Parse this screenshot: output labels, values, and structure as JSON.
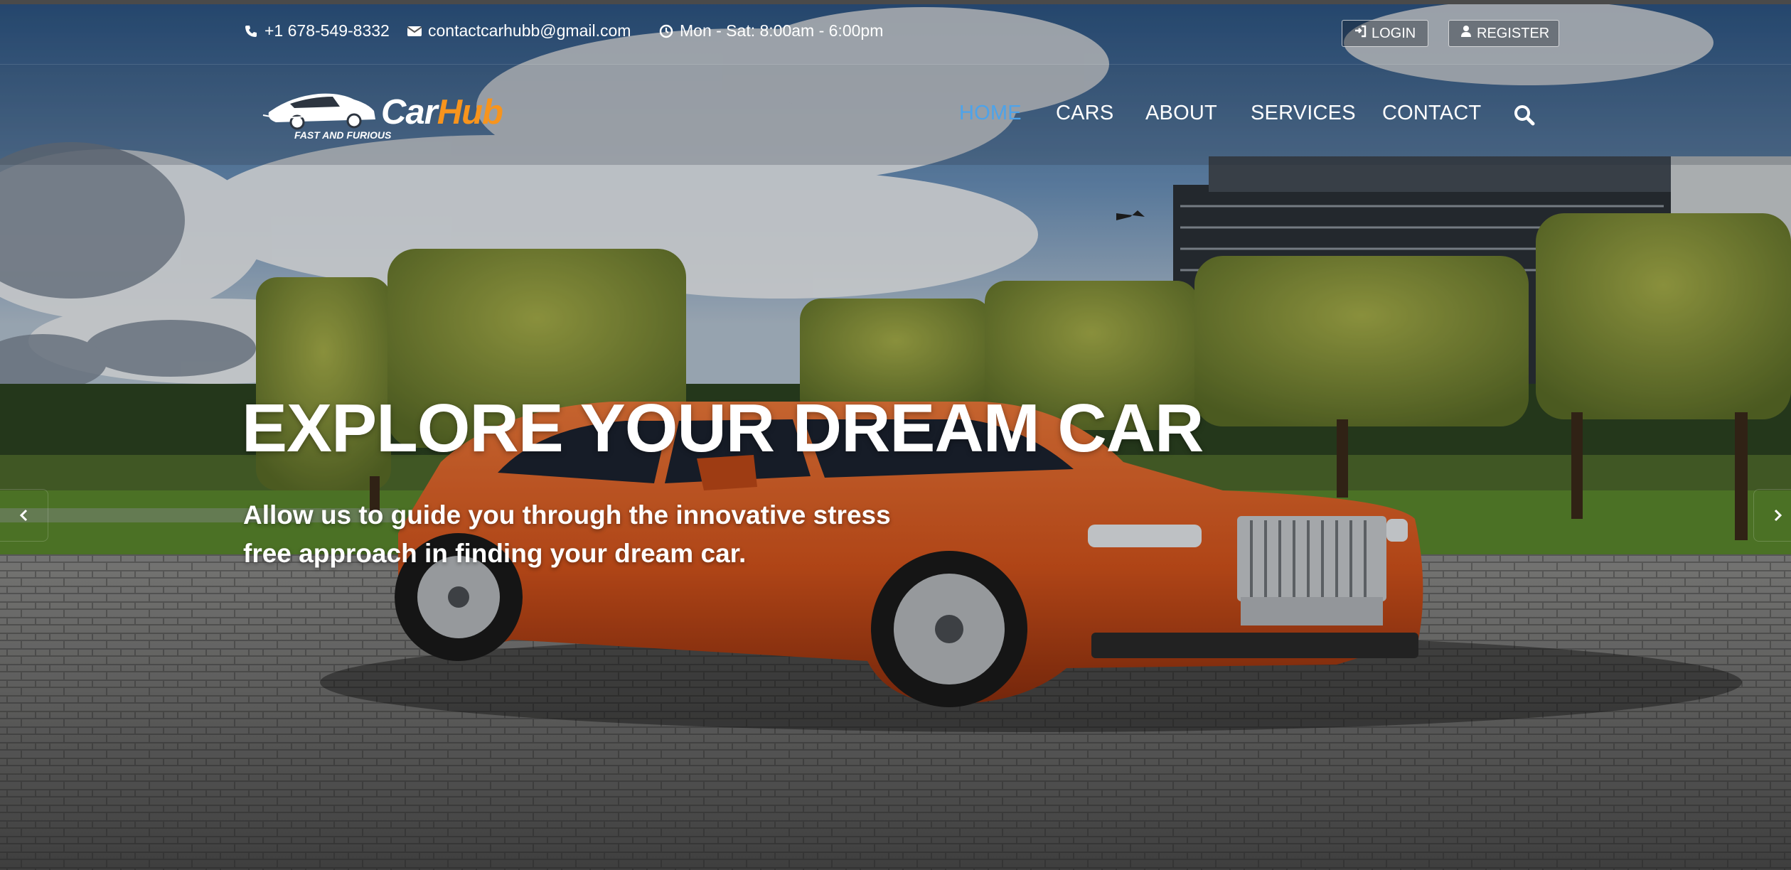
{
  "topbar": {
    "phone": "+1 678-549-8332",
    "email": "contactcarhubb@gmail.com",
    "hours": "Mon - Sat: 8:00am - 6:00pm",
    "login_label": "LOGIN",
    "register_label": "REGISTER"
  },
  "brand": {
    "name_part1": "Car",
    "name_part2": "Hub",
    "tagline": "FAST AND FURIOUS"
  },
  "nav": {
    "items": [
      {
        "label": "HOME",
        "active": true
      },
      {
        "label": "CARS",
        "active": false
      },
      {
        "label": "ABOUT",
        "active": false
      },
      {
        "label": "SERVICES",
        "active": false
      },
      {
        "label": "CONTACT",
        "active": false
      }
    ]
  },
  "hero": {
    "title": "EXPLORE YOUR DREAM CAR",
    "subtitle_line1": "Allow us to guide you through the innovative stress",
    "subtitle_line2": "free approach in finding your dream car."
  },
  "icons": {
    "phone": "phone-icon",
    "email": "envelope-icon",
    "hours": "clock-icon",
    "login": "sign-in-icon",
    "register": "user-icon",
    "search": "search-icon",
    "prev": "chevron-left-icon",
    "next": "chevron-right-icon"
  },
  "colors": {
    "accent_active": "#4da3ea",
    "brand_orange": "#f7941d",
    "car_orange": "#e0581c"
  }
}
